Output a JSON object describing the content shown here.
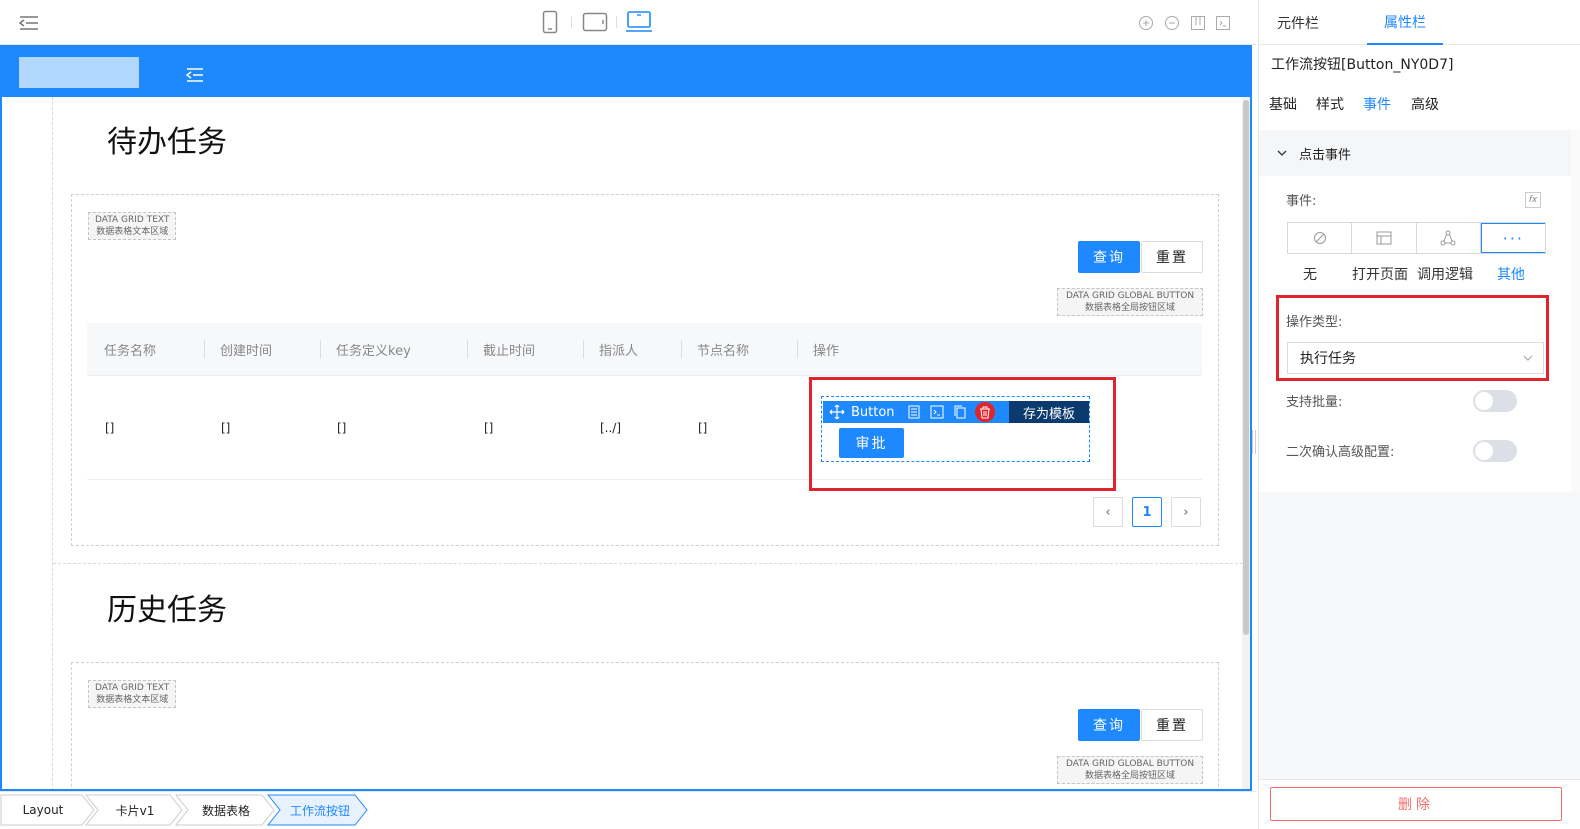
{
  "panel": {
    "tabs": [
      {
        "label": "元件栏"
      },
      {
        "label": "属性栏"
      }
    ],
    "component_title": "工作流按钮[Button_NY0D7]",
    "subtabs": [
      {
        "label": "基础"
      },
      {
        "label": "样式"
      },
      {
        "label": "事件"
      },
      {
        "label": "高级"
      }
    ],
    "section": "点击事件",
    "event_label": "事件:",
    "event_options": [
      {
        "label": "无"
      },
      {
        "label": "打开页面"
      },
      {
        "label": "调用逻辑"
      },
      {
        "label": "其他"
      }
    ],
    "op_type_label": "操作类型:",
    "op_type_value": "执行任务",
    "batch_label": "支持批量:",
    "confirm_label": "二次确认高级配置:",
    "delete_label": "删除",
    "fx": "fx"
  },
  "canvas": {
    "section1_title": "待办任务",
    "section2_title": "历史任务",
    "grid_text_tag": [
      "DATA GRID TEXT",
      "数据表格文本区域"
    ],
    "grid_button_tag": [
      "DATA GRID GLOBAL BUTTON",
      "数据表格全局按钮区域"
    ],
    "query_label": "查询",
    "reset_label": "重置",
    "columns": [
      "任务名称",
      "创建时间",
      "任务定义key",
      "截止时间",
      "指派人",
      "节点名称",
      "操作"
    ],
    "row": [
      "[]",
      "[]",
      "[]",
      "[]",
      "[../]",
      "[]"
    ],
    "selected_component": "Button",
    "save_template": "存为模板",
    "approve_label": "审批",
    "page": "1"
  },
  "breadcrumb": [
    {
      "label": "Layout"
    },
    {
      "label": "卡片v1"
    },
    {
      "label": "数据表格"
    },
    {
      "label": "工作流按钮"
    }
  ],
  "colors": {
    "primary": "#1e88ff",
    "highlight_red": "#e0242b",
    "danger": "#f56c6c"
  }
}
